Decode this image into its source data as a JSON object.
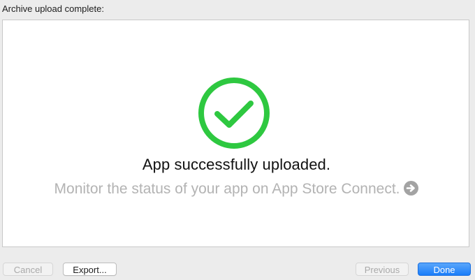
{
  "header": {
    "label": "Archive upload complete:"
  },
  "status": {
    "icon": "checkmark-circle-icon",
    "accent_color": "#2ec840",
    "title": "App successfully uploaded.",
    "monitor_text": "Monitor the status of your app on App Store Connect.",
    "monitor_icon": "arrow-right-circle-icon"
  },
  "footer": {
    "cancel_label": "Cancel",
    "export_label": "Export...",
    "previous_label": "Previous",
    "done_label": "Done"
  },
  "colors": {
    "primary_button": "#1a7df9",
    "muted_text": "#b3b3b3"
  }
}
